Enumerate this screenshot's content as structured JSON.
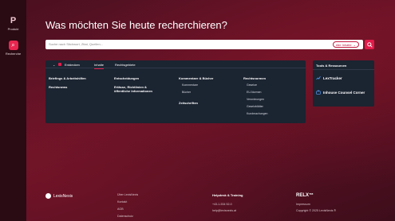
{
  "rail": {
    "produkt_label": "Produkt",
    "recherche_label": "Recherche",
    "produkt_icon": "P",
    "recherche_icon": "⌕"
  },
  "page_title": "Was möchten Sie heute recherchieren?",
  "search": {
    "placeholder": "Suche nach Stichwort, Zitat, Quellen...",
    "scope_label": "Alle Inhalte",
    "scope_icon": "⌄"
  },
  "tabs": {
    "collapse_icon": "⌄",
    "entdecken": "Entdecken",
    "inhalte": "Inhalte",
    "rechtsgebiete": "Rechtsgebiete"
  },
  "columns": [
    {
      "head": "Briefings & Arbeitshilfen",
      "head2": "Rechtsnews"
    },
    {
      "head": "Entscheidungen",
      "head2": "Erlässe, Richtlinien &",
      "head3": "öffentliche Informationen"
    },
    {
      "head": "Kommentare & Bücher",
      "subs": [
        "Kommentare",
        "Bücher"
      ],
      "head2": "Zeitschriften"
    },
    {
      "head": "Rechtsnormen",
      "subs": [
        "Gesetze",
        "EU-Normen",
        "Verordnungen",
        "Gesetzblätter",
        "Kundmachungen"
      ]
    }
  ],
  "tools": {
    "title": "Tools & Ressourcen",
    "items": [
      "LexTracker",
      "Inhouse Counsel Corner"
    ]
  },
  "footer": {
    "brand": "LexisNexis",
    "links": [
      "Über LexisNexis",
      "Kontakt",
      "AGB",
      "Datenschutz"
    ],
    "helpdesk_title": "Helpdesk & Training",
    "phone": "+43-1-534 52-0",
    "email": "help@lexisnexis.at",
    "relx": "RELX™",
    "impressum": "Impressum",
    "copyright": "Copyright © 2025 LexisNexis ®"
  },
  "colors": {
    "accent": "#e21c4a",
    "panel": "#1b2431",
    "background": "#5a1124"
  }
}
